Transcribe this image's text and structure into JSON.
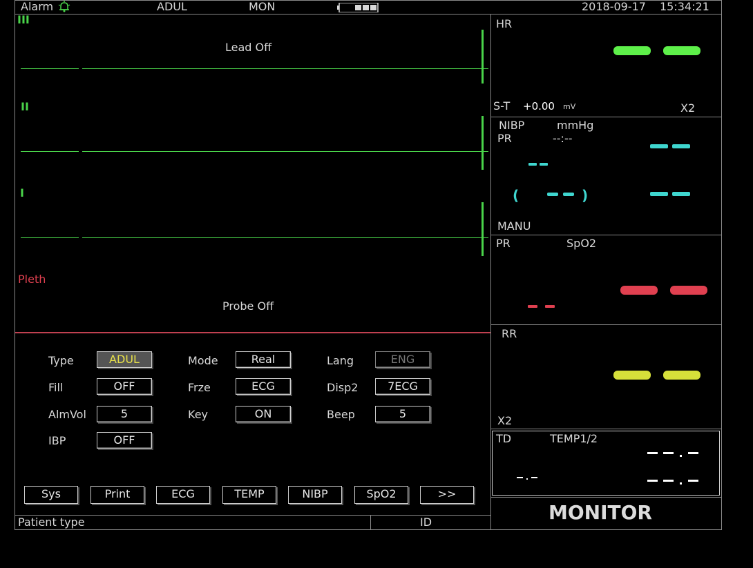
{
  "top_bar": {
    "alarm_label": "Alarm",
    "patient_type": "ADUL",
    "mode": "MON",
    "date": "2018-09-17",
    "time": "15:34:21"
  },
  "waveforms": {
    "lead_iii": "III",
    "lead_ii": "II",
    "lead_i": "I",
    "ecg_status": "Lead Off",
    "pleth_label": "Pleth",
    "pleth_status": "Probe Off"
  },
  "hr_panel": {
    "title": "HR",
    "st_label": "S-T",
    "st_value": "+0.00",
    "st_unit": "mV",
    "gain": "X2"
  },
  "nibp_panel": {
    "title": "NIBP",
    "unit": "mmHg",
    "pr_label": "PR",
    "time_value": "--:--",
    "mode": "MANU"
  },
  "spo2_panel": {
    "pr_label": "PR",
    "title": "SpO2"
  },
  "rr_panel": {
    "title": "RR",
    "gain": "X2"
  },
  "temp_panel": {
    "td_label": "TD",
    "title": "TEMP1/2"
  },
  "brand": "MONITOR",
  "settings": {
    "type_label": "Type",
    "type_value": "ADUL",
    "fill_label": "Fill",
    "fill_value": "OFF",
    "almvol_label": "AlmVol",
    "almvol_value": "5",
    "ibp_label": "IBP",
    "ibp_value": "OFF",
    "mode_label": "Mode",
    "mode_value": "Real",
    "frze_label": "Frze",
    "frze_value": "ECG",
    "key_label": "Key",
    "key_value": "ON",
    "lang_label": "Lang",
    "lang_value": "ENG",
    "disp2_label": "Disp2",
    "disp2_value": "7ECG",
    "beep_label": "Beep",
    "beep_value": "5"
  },
  "menu_buttons": [
    "Sys",
    "Print",
    "ECG",
    "TEMP",
    "NIBP",
    "SpO2",
    ">>"
  ],
  "status_bar": {
    "left": "Patient type",
    "right": "ID"
  },
  "colors": {
    "ecg": "#4ad44a",
    "pleth": "#e04050",
    "nibp": "#3fd6cf",
    "rr": "#d6df3a",
    "selected": "#e7e04a"
  }
}
